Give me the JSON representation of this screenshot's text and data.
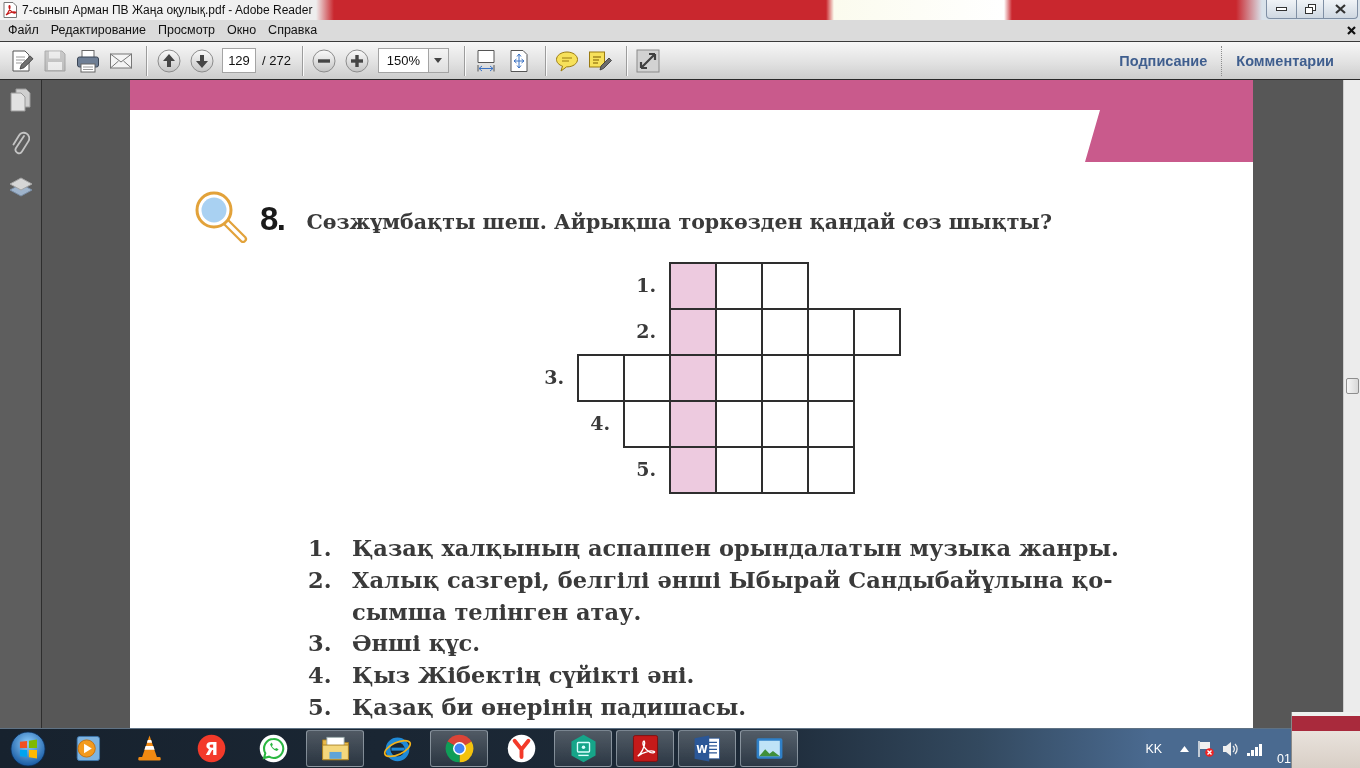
{
  "window": {
    "title": "7-сынып Арман ПВ Жаңа оқулық.pdf - Adobe Reader"
  },
  "menu": [
    "Файл",
    "Редактирование",
    "Просмотр",
    "Окно",
    "Справка"
  ],
  "toolbar": {
    "groups": [
      {
        "items": [
          {
            "kind": "create",
            "disabled": false
          },
          {
            "kind": "save",
            "disabled": true
          },
          {
            "kind": "print",
            "disabled": false
          },
          {
            "kind": "email",
            "disabled": false
          }
        ]
      },
      {
        "items": [
          {
            "kind": "prev",
            "disabled": false
          },
          {
            "kind": "next",
            "disabled": false
          },
          {
            "kind": "page",
            "value": "129"
          },
          {
            "kind": "count",
            "text": "/ 272"
          }
        ]
      },
      {
        "items": [
          {
            "kind": "zoomout",
            "disabled": false
          },
          {
            "kind": "zoomin",
            "disabled": false
          },
          {
            "kind": "zoom",
            "value": "150%"
          }
        ]
      },
      {
        "items": [
          {
            "kind": "fitpage",
            "disabled": false
          },
          {
            "kind": "fitwidth",
            "disabled": false
          }
        ]
      },
      {
        "items": [
          {
            "kind": "comment",
            "disabled": false
          },
          {
            "kind": "highlight",
            "disabled": false
          }
        ]
      },
      {
        "items": [
          {
            "kind": "fullscreen",
            "disabled": false
          }
        ]
      }
    ],
    "panels": [
      "Подписание",
      "Комментарии"
    ]
  },
  "document": {
    "task": {
      "number": "8.",
      "text": "Сөзжұмбақты шеш. Айрықша торкөзден қандай сөз шықты?"
    },
    "crossword": {
      "rows": [
        {
          "label": "1.",
          "cells": [
            {
              "kind": "gap"
            },
            {
              "kind": "gap"
            },
            {
              "kind": "gap"
            },
            {
              "kind": "box",
              "highlighted": true
            },
            {
              "kind": "box",
              "highlighted": false
            },
            {
              "kind": "box",
              "highlighted": false
            }
          ]
        },
        {
          "label": "2.",
          "cells": [
            {
              "kind": "gap"
            },
            {
              "kind": "gap"
            },
            {
              "kind": "gap"
            },
            {
              "kind": "box",
              "highlighted": true
            },
            {
              "kind": "box",
              "highlighted": false
            },
            {
              "kind": "box",
              "highlighted": false
            },
            {
              "kind": "box",
              "highlighted": false
            },
            {
              "kind": "box",
              "highlighted": false
            }
          ]
        },
        {
          "label": "3.",
          "cells": [
            {
              "kind": "gap"
            },
            {
              "kind": "box",
              "highlighted": false
            },
            {
              "kind": "box",
              "highlighted": false
            },
            {
              "kind": "box",
              "highlighted": true
            },
            {
              "kind": "box",
              "highlighted": false
            },
            {
              "kind": "box",
              "highlighted": false
            },
            {
              "kind": "box",
              "highlighted": false
            }
          ]
        },
        {
          "label": "4.",
          "cells": [
            {
              "kind": "gap"
            },
            {
              "kind": "gap"
            },
            {
              "kind": "box",
              "highlighted": false
            },
            {
              "kind": "box",
              "highlighted": true
            },
            {
              "kind": "box",
              "highlighted": false
            },
            {
              "kind": "box",
              "highlighted": false
            },
            {
              "kind": "box",
              "highlighted": false
            }
          ]
        },
        {
          "label": "5.",
          "cells": [
            {
              "kind": "gap"
            },
            {
              "kind": "gap"
            },
            {
              "kind": "gap"
            },
            {
              "kind": "box",
              "highlighted": true
            },
            {
              "kind": "box",
              "highlighted": false
            },
            {
              "kind": "box",
              "highlighted": false
            },
            {
              "kind": "box",
              "highlighted": false
            }
          ]
        }
      ]
    },
    "clues": [
      {
        "number": "1.",
        "lines": [
          "Қазақ халқының аспаппен орындалатын музыка жанры."
        ]
      },
      {
        "number": "2.",
        "lines": [
          "Халық сазгері, белгілі әнші Ыбырай Сандыбайұлына қо-",
          "сымша телінген атау."
        ]
      },
      {
        "number": "3.",
        "lines": [
          "Әнші құс."
        ]
      },
      {
        "number": "4.",
        "lines": [
          "Қыз Жібектің сүйікті әні."
        ]
      },
      {
        "number": "5.",
        "lines": [
          "Қазақ би өнерінің падишасы."
        ]
      }
    ]
  },
  "taskbar": {
    "apps": [
      {
        "kind": "player",
        "running": false
      },
      {
        "kind": "cone",
        "running": false
      },
      {
        "kind": "letter",
        "glyph": "Я",
        "running": false
      },
      {
        "kind": "chat",
        "running": false
      },
      {
        "kind": "folder",
        "running": true
      },
      {
        "kind": "ie",
        "running": false
      },
      {
        "kind": "chrome",
        "running": true
      },
      {
        "kind": "ybrowser",
        "running": false
      },
      {
        "kind": "hexapp",
        "running": true
      },
      {
        "kind": "acrobat",
        "running": true
      },
      {
        "kind": "word",
        "glyph": "W",
        "running": true
      },
      {
        "kind": "photos",
        "running": true
      }
    ],
    "language": "KK",
    "clock": "01"
  }
}
